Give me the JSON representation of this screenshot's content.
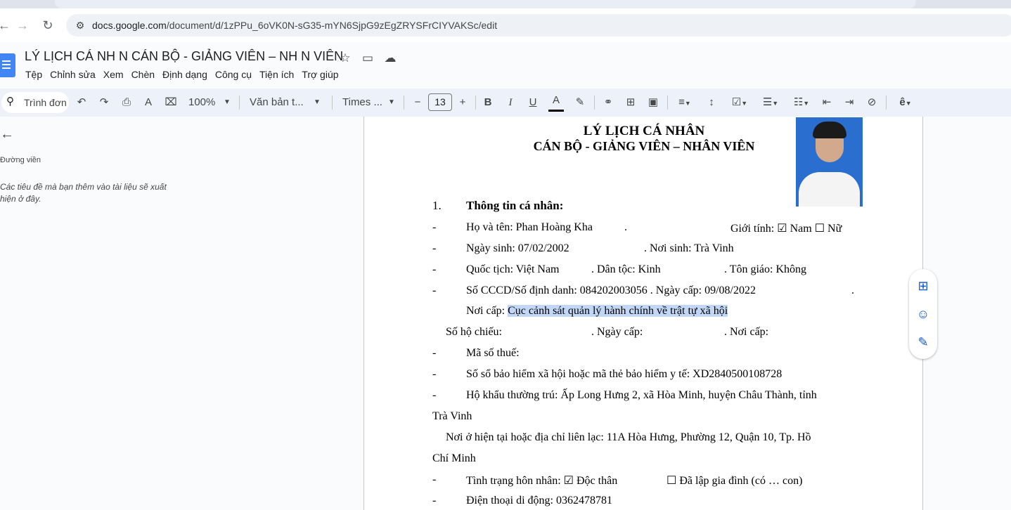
{
  "browser": {
    "url_host": "docs.google.com",
    "url_path": "/document/d/1zPPu_6oVK0N-sG35-mYN6SjpG9zEgZRYSFrCIYVAKSc/edit"
  },
  "docs": {
    "title": "LÝ LỊCH CÁ NH N CÁN BỘ - GIẢNG VIÊN – NH N VIÊN",
    "menu": [
      "Tệp",
      "Chỉnh sửa",
      "Xem",
      "Chèn",
      "Định dạng",
      "Công cụ",
      "Tiện ích",
      "Trợ giúp"
    ]
  },
  "toolbar": {
    "search_placeholder": "Trình đơn",
    "zoom": "100%",
    "style": "Văn bản t...",
    "font": "Times ...",
    "font_size": "13"
  },
  "sidebar": {
    "outline_label": "Đường viền",
    "outline_hint": "Các tiêu đề mà bạn thêm vào tài liệu sẽ xuất hiện ở đây."
  },
  "document": {
    "heading1": "LÝ LỊCH CÁ NHÂN",
    "heading2": "CÁN BỘ - GIẢNG VIÊN – NHÂN VIÊN",
    "section1_num": "1.",
    "section1_title": "Thông tin cá nhân:",
    "dash": "-",
    "name_line": "Họ và tên: Phan Hoàng Kha",
    "name_dot": ".",
    "gender": "Giới tính: ☑ Nam   ☐ Nữ",
    "dob": "Ngày sinh: 07/02/2002",
    "pob": ". Nơi sinh: Trà Vinh",
    "nationality": "Quốc tịch: Việt Nam",
    "ethnicity": ". Dân tộc: Kinh",
    "religion": ". Tôn giáo: Không",
    "id_line": "Số CCCD/Số định danh:  084202003056 . Ngày cấp: 09/08/2022",
    "id_dot": ".",
    "issued_label": "Nơi cấp: ",
    "issued_value": "Cục cảnh sát quản lý hành chính về trật tự xã hội",
    "passport": "Số hộ chiếu:",
    "passport_date": ". Ngày cấp:",
    "passport_place": ". Nơi cấp:",
    "tax": "Mã số thuế:",
    "insurance": "Số sổ bảo hiểm xã hội hoặc mã thẻ bảo hiểm y tế:  XD2840500108728",
    "residence_1": "Hộ khẩu thường trú: Ấp Long Hưng 2, xã Hòa Minh, huyện Châu Thành, tỉnh",
    "residence_2": "Trà Vinh",
    "address_1": "Nơi ở hiện tại hoặc địa chỉ liên lạc: 11A Hòa Hưng, Phường 12, Quận 10, Tp. Hồ",
    "address_2": "Chí Minh",
    "marital": "Tình trạng hôn nhân:  ☑ Độc thân",
    "marital_2": "☐ Đã lập gia đình (có … con)",
    "phone_partial": "Điện thoại di động:   0362478781"
  }
}
